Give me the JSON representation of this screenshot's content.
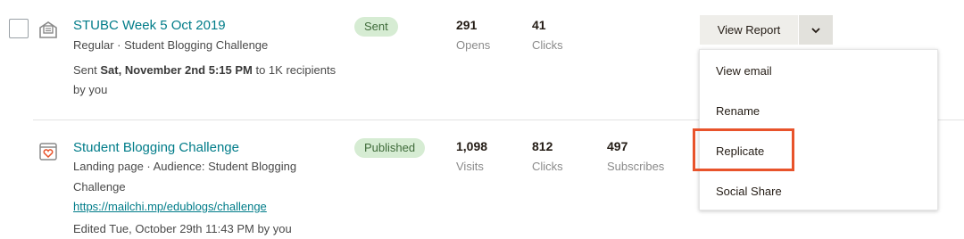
{
  "campaign1": {
    "title": "STUBC Week 5 Oct 2019",
    "type_line": "Regular · Student Blogging Challenge",
    "sent_prefix": "Sent ",
    "sent_datetime": "Sat, November 2nd 5:15 PM",
    "sent_suffix": " to 1K recipients",
    "by_line": "by you",
    "status": "Sent",
    "stat1_value": "291",
    "stat1_label": "Opens",
    "stat2_value": "41",
    "stat2_label": "Clicks",
    "report_button": "View Report"
  },
  "campaign2": {
    "title": "Student Blogging Challenge",
    "type_line1": "Landing page · Audience: Student Blogging",
    "type_line2": "Challenge",
    "url": "https://mailchi.mp/edublogs/challenge",
    "edited_line": "Edited Tue, October 29th 11:43 PM by you",
    "status": "Published",
    "stat1_value": "1,098",
    "stat1_label": "Visits",
    "stat2_value": "812",
    "stat2_label": "Clicks",
    "stat3_value": "497",
    "stat3_label": "Subscribes"
  },
  "dropdown": {
    "items": [
      "View email",
      "Rename",
      "Replicate",
      "Social Share"
    ],
    "highlighted": "Replicate"
  },
  "colors": {
    "link": "#007c89",
    "sent_badge": "#d6ecd3",
    "highlight_box": "#e8532b"
  }
}
